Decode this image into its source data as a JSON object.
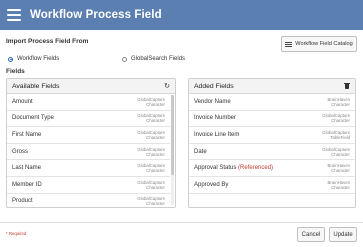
{
  "dialog": {
    "title": "Workflow Process Field",
    "title_icon": "hamburger-menu-icon"
  },
  "import": {
    "label": "Import Process Field From",
    "catalog_button": "Workflow Field Catalog",
    "catalog_icon": "list-icon",
    "options": [
      {
        "label": "Workflow Fields",
        "checked": true
      },
      {
        "label": "GlobalSearch Fields",
        "checked": false
      }
    ]
  },
  "fields_label": "Fields",
  "available": {
    "title": "Available Fields",
    "action_icon": "refresh-icon",
    "items": [
      {
        "name": "Amount",
        "source": "GlobalCapture",
        "type": "Character"
      },
      {
        "name": "Document Type",
        "source": "GlobalCapture",
        "type": "Character"
      },
      {
        "name": "First Name",
        "source": "GlobalCapture",
        "type": "Character"
      },
      {
        "name": "Gross",
        "source": "GlobalCapture",
        "type": "Character"
      },
      {
        "name": "Last Name",
        "source": "GlobalCapture",
        "type": "Character"
      },
      {
        "name": "Member ID",
        "source": "GlobalCapture",
        "type": "Character"
      },
      {
        "name": "Product",
        "source": "GlobalCapture",
        "type": "Character"
      }
    ]
  },
  "added": {
    "title": "Added Fields",
    "action_icon": "trash-icon",
    "items": [
      {
        "name": "Vendor Name",
        "ref": "",
        "source": "BrainHaven",
        "type": "Character"
      },
      {
        "name": "Invoice Number",
        "ref": "",
        "source": "GlobalCapture",
        "type": "Character"
      },
      {
        "name": "Invoice Line Item",
        "ref": "",
        "source": "GlobalCapture",
        "type": "TableField"
      },
      {
        "name": "Date",
        "ref": "",
        "source": "GlobalCapture",
        "type": "Character"
      },
      {
        "name": "Approval Status ",
        "ref": "(Referenced)",
        "source": "BrainHaven",
        "type": "Character"
      },
      {
        "name": "Approved By",
        "ref": "",
        "source": "BrainHaven",
        "type": "Character"
      }
    ]
  },
  "footer": {
    "required_note": "* Required",
    "cancel": "Cancel",
    "update": "Update"
  },
  "colors": {
    "titlebar": "#5b7fb1",
    "required": "#c0392b"
  }
}
